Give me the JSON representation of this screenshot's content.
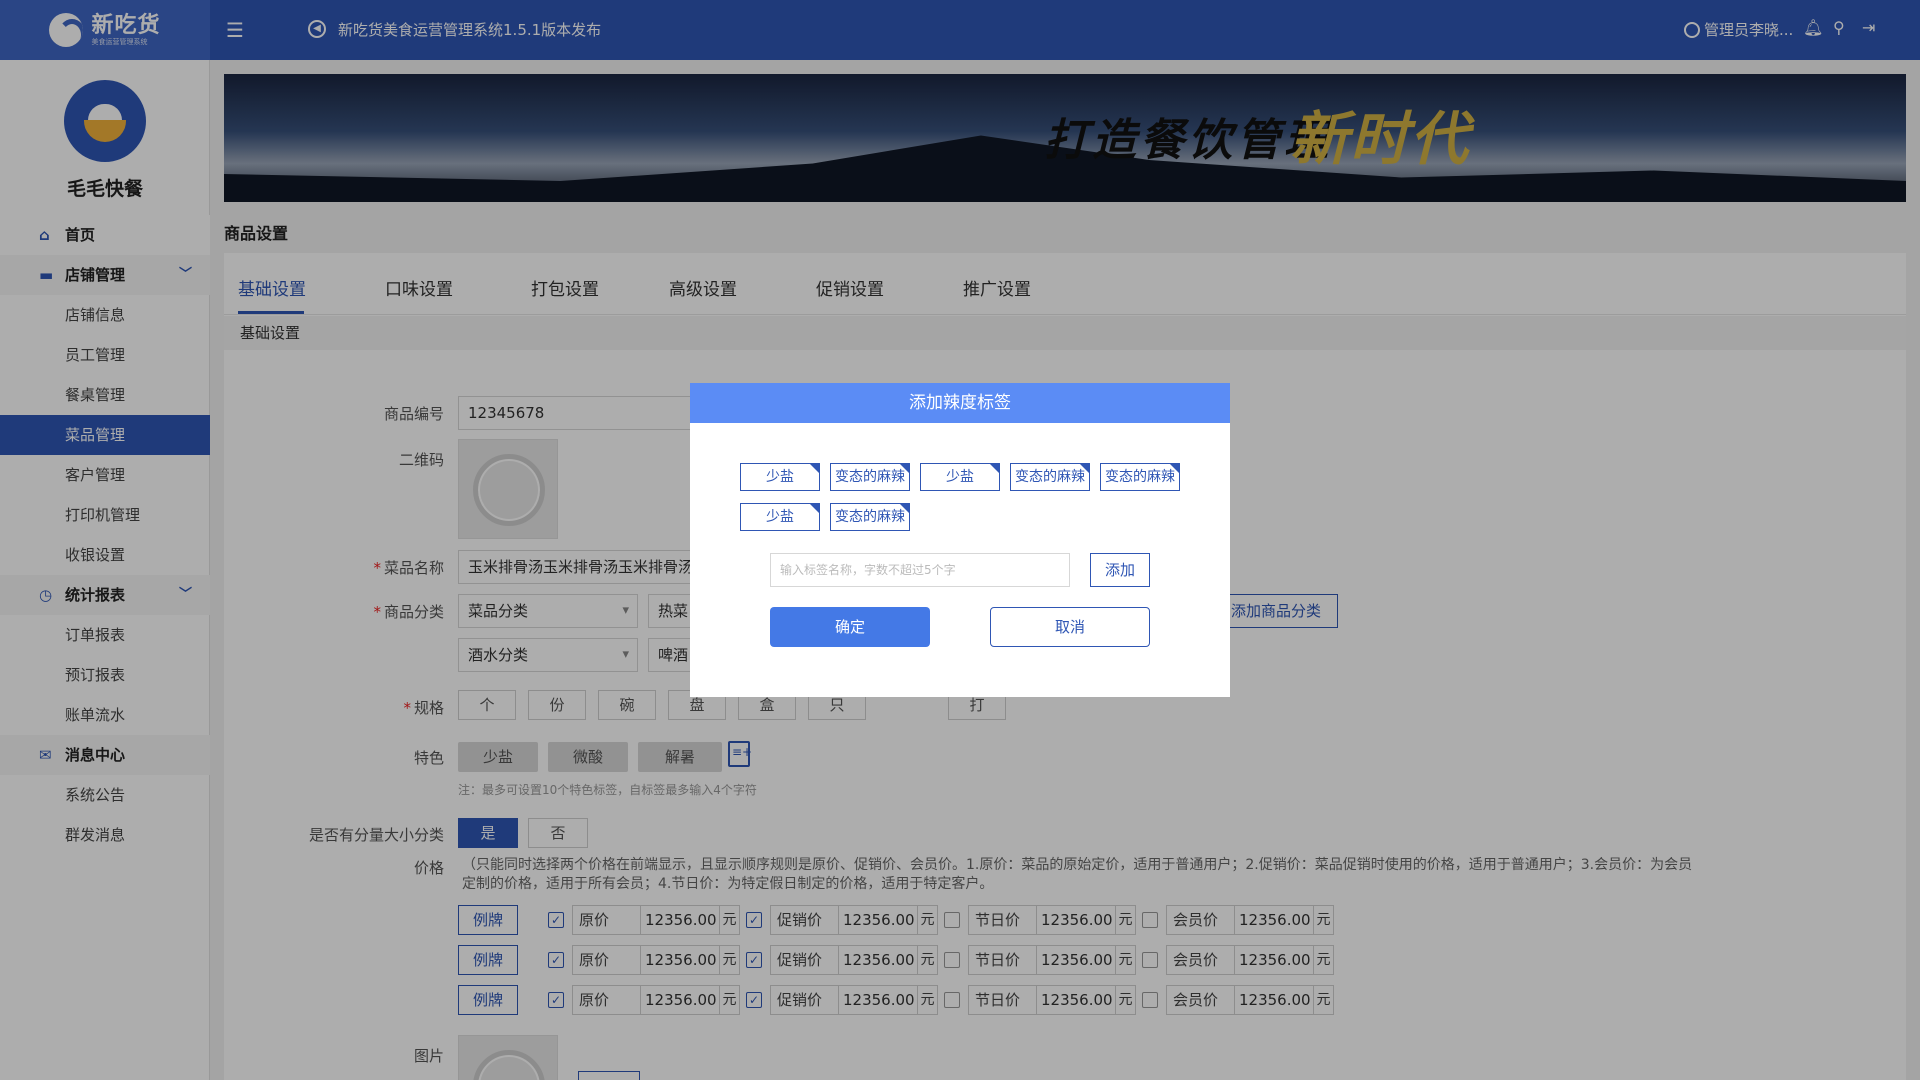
{
  "topbar": {
    "logo_text": "新吃货",
    "logo_sub": "美食运营管理系统",
    "notice": "新吃货美食运营管理系统1.5.1版本发布",
    "admin": "管理员李晓..."
  },
  "sidebar": {
    "shop_name": "毛毛快餐",
    "items": [
      {
        "label": "首页",
        "type": "group",
        "icon": "home-icon"
      },
      {
        "label": "店铺管理",
        "type": "group",
        "icon": "store-icon"
      },
      {
        "label": "店铺信息",
        "type": "sub"
      },
      {
        "label": "员工管理",
        "type": "sub"
      },
      {
        "label": "餐桌管理",
        "type": "sub"
      },
      {
        "label": "菜品管理",
        "type": "sub",
        "active": true
      },
      {
        "label": "客户管理",
        "type": "sub"
      },
      {
        "label": "打印机管理",
        "type": "sub"
      },
      {
        "label": "收银设置",
        "type": "sub"
      },
      {
        "label": "统计报表",
        "type": "group",
        "icon": "clock-icon"
      },
      {
        "label": "订单报表",
        "type": "sub"
      },
      {
        "label": "预订报表",
        "type": "sub"
      },
      {
        "label": "账单流水",
        "type": "sub"
      },
      {
        "label": "消息中心",
        "type": "group",
        "icon": "mail-icon"
      },
      {
        "label": "系统公告",
        "type": "sub"
      },
      {
        "label": "群发消息",
        "type": "sub"
      }
    ]
  },
  "banner": {
    "slogan": "打造餐饮管理",
    "slogan_highlight": "新时代"
  },
  "page_title": "商品设置",
  "tabs": [
    "基础设置",
    "口味设置",
    "打包设置",
    "高级设置",
    "促销设置",
    "推广设置"
  ],
  "section_title": "基础设置",
  "form": {
    "code_label": "商品编号",
    "code_value": "12345678",
    "qr_label": "二维码",
    "name_label": "菜品名称",
    "name_value": "玉米排骨汤玉米排骨汤玉米排骨汤玉",
    "category_label": "商品分类",
    "cat1": "菜品分类",
    "cat1_value": "热菜",
    "cat2": "酒水分类",
    "cat2_value": "啤酒",
    "add_category": "添加商品分类",
    "spec_label": "规格",
    "specs": [
      "个",
      "份",
      "碗",
      "盘",
      "盒",
      "只",
      "打"
    ],
    "feature_label": "特色",
    "features": [
      "少盐",
      "微酸",
      "解暑"
    ],
    "feature_note": "注：最多可设置10个特色标签，自标签最多输入4个字符",
    "size_label": "是否有分量大小分类",
    "yes": "是",
    "no": "否",
    "price_label": "价格",
    "price_note": "（只能同时选择两个价格在前端显示，且显示顺序规则是原价、促销价、会员价。1.原价：菜品的原始定价，适用于普通用户；2.促销价：菜品促销时使用的价格，适用于普通用户；3.会员价：为会员定制的价格，适用于所有会员；4.节日价：为特定假日制定的价格，适用于特定客户。",
    "price_rows": [
      {
        "tag": "例牌",
        "orig": "12356.00",
        "promo": "12356.00",
        "holiday": "12356.00",
        "member": "12356.00"
      },
      {
        "tag": "例牌",
        "orig": "12356.00",
        "promo": "12356.00",
        "holiday": "12356.00",
        "member": "12356.00"
      },
      {
        "tag": "例牌",
        "orig": "12356.00",
        "promo": "12356.00",
        "holiday": "12356.00",
        "member": "12356.00"
      }
    ],
    "price_keys": {
      "orig": "原价",
      "promo": "促销价",
      "holiday": "节日价",
      "member": "会员价",
      "unit": "元"
    },
    "image_label": "图片"
  },
  "modal": {
    "title": "添加辣度标签",
    "chips": [
      "少盐",
      "变态的麻辣",
      "少盐",
      "变态的麻辣",
      "变态的麻辣",
      "少盐",
      "变态的麻辣"
    ],
    "input_placeholder": "输入标签名称，字数不超过5个字",
    "add": "添加",
    "ok": "确定",
    "cancel": "取消"
  },
  "colors": {
    "primary": "#2f56b4",
    "header": "#2f56b4",
    "modal_header": "#5b8cf5"
  }
}
